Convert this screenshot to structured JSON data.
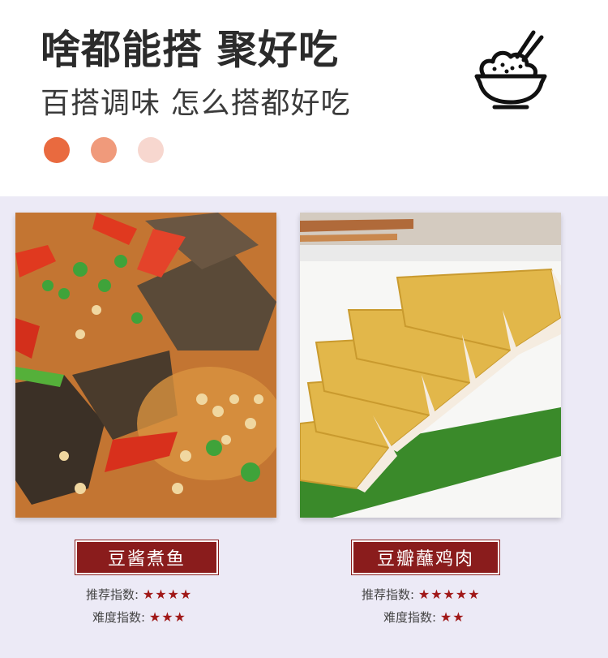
{
  "header": {
    "title": "啥都能搭  聚好吃",
    "subtitle": "百搭调味  怎么搭都好吃",
    "icon": "rice-bowl-chopsticks-icon",
    "dot_colors": [
      "#e96a3f",
      "#f09a7b",
      "#f7d7cf"
    ]
  },
  "dishes": [
    {
      "name": "豆酱煮鱼",
      "photo": "braised fish with chili and soybean",
      "recommend_label": "推荐指数:",
      "recommend_stars": "★★★★",
      "recommend_value": 4,
      "difficulty_label": "难度指数:",
      "difficulty_stars": "★★★",
      "difficulty_value": 3
    },
    {
      "name": "豆瓣蘸鸡肉",
      "photo": "sliced poached chicken on leaf",
      "recommend_label": "推荐指数:",
      "recommend_stars": "★★★★★",
      "recommend_value": 5,
      "difficulty_label": "难度指数:",
      "difficulty_stars": "★★",
      "difficulty_value": 2
    }
  ],
  "colors": {
    "banner": "#8a1c1c",
    "star": "#a01818",
    "panel_bg": "#eceaf6"
  }
}
